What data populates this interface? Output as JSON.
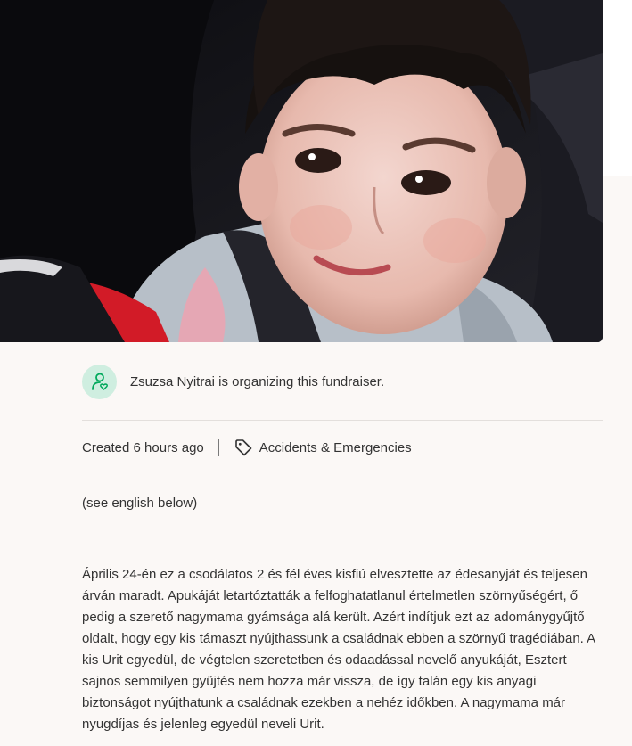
{
  "organizer": {
    "text": "Zsuzsa Nyitrai is organizing this fundraiser.",
    "icon": "user-heart-icon"
  },
  "meta": {
    "created": "Created 6 hours ago",
    "category": "Accidents & Emergencies",
    "category_icon": "tag-icon"
  },
  "story": {
    "intro": "(see english below)",
    "paragraph": "Április 24-én ez a csodálatos 2 és fél éves kisfiú elvesztette az édesanyját és teljesen árván maradt. Apukáját letartóztatták a felfoghatatlanul értelmetlen szörnyűségért, ő pedig a szerető nagymama gyámsága alá került. Azért indítjuk ezt az adománygyűjtő oldalt, hogy egy kis támaszt nyújthassunk a családnak ebben a szörnyű tragédiában. A kis Urit egyedül, de végtelen szeretetben és odaadással nevelő anyukáját, Esztert sajnos semmilyen gyűjtés nem hozza már vissza, de így talán egy kis anyagi biztonságot nyújthatunk a családnak ezekben a nehéz időkben. A nagymama már nyugdíjas és jelenleg egyedül neveli Urit."
  },
  "colors": {
    "page_bg": "#fbf8f6",
    "avatar_bg": "#cfeee0",
    "avatar_icon": "#02a95c",
    "divider": "#e3dfdc",
    "text": "#333333"
  }
}
